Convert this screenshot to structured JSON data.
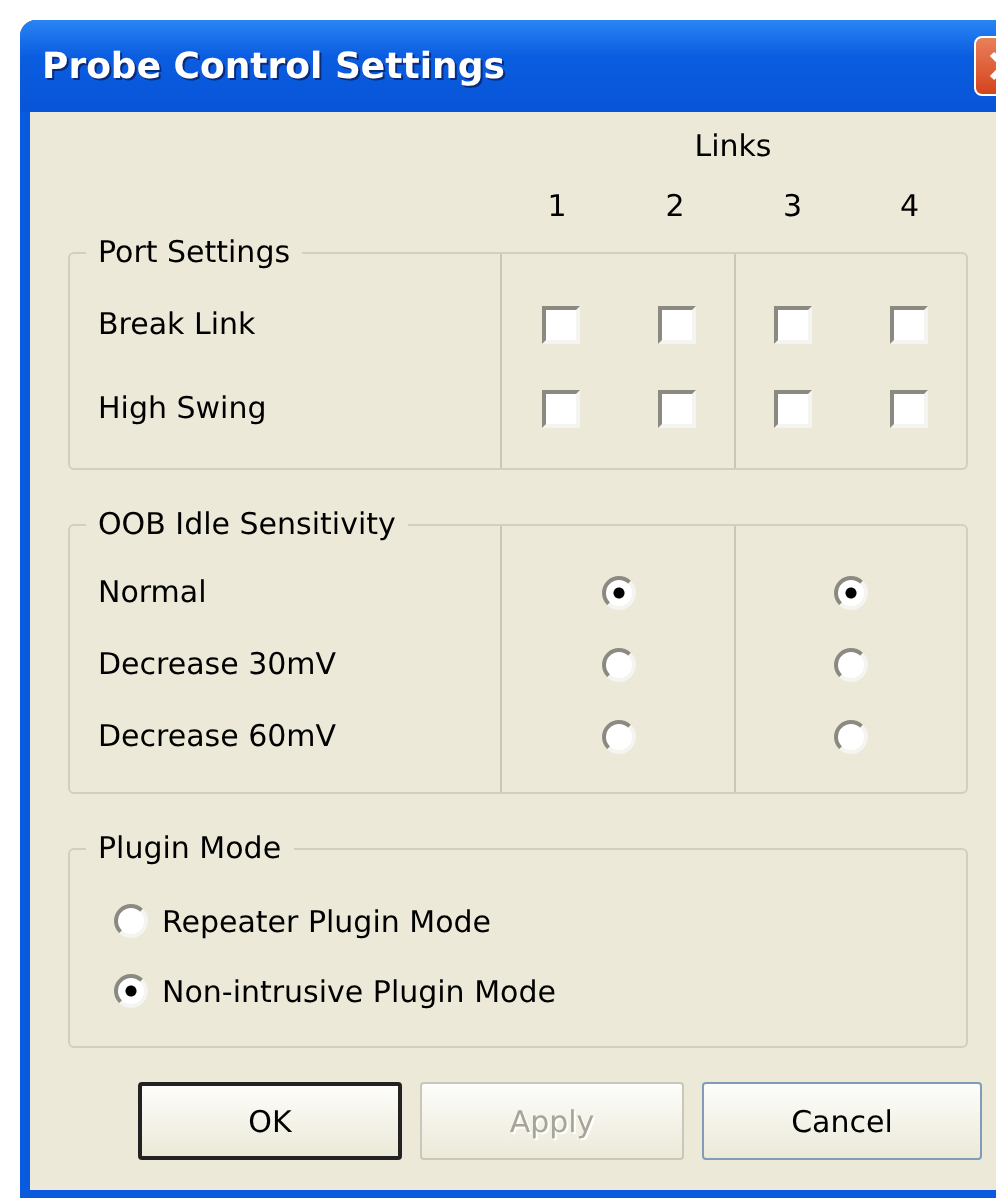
{
  "window": {
    "title": "Probe Control Settings"
  },
  "links_header": "Links",
  "columns": [
    "1",
    "2",
    "3",
    "4"
  ],
  "port_settings": {
    "label": "Port Settings",
    "rows": [
      {
        "label": "Break Link",
        "checks": [
          {
            "checked": false
          },
          {
            "checked": false
          },
          {
            "checked": false
          },
          {
            "checked": false
          }
        ]
      },
      {
        "label": "High Swing",
        "checks": [
          {
            "checked": false
          },
          {
            "checked": false
          },
          {
            "checked": false
          },
          {
            "checked": false
          }
        ]
      }
    ]
  },
  "oob_idle_sensitivity": {
    "label": "OOB Idle Sensitivity",
    "rows": [
      {
        "label": "Normal",
        "options": [
          {
            "selected": true
          },
          {
            "selected": true
          }
        ]
      },
      {
        "label": "Decrease 30mV",
        "options": [
          {
            "selected": false
          },
          {
            "selected": false
          }
        ]
      },
      {
        "label": "Decrease 60mV",
        "options": [
          {
            "selected": false
          },
          {
            "selected": false
          }
        ]
      }
    ]
  },
  "plugin_mode": {
    "label": "Plugin Mode",
    "options": [
      {
        "label": "Repeater Plugin Mode",
        "selected": false
      },
      {
        "label": "Non-intrusive Plugin Mode",
        "selected": true
      }
    ]
  },
  "buttons": [
    {
      "label": "OK",
      "default": true,
      "disabled": false
    },
    {
      "label": "Apply",
      "default": false,
      "disabled": true
    },
    {
      "label": "Cancel",
      "default": false,
      "disabled": false
    }
  ]
}
